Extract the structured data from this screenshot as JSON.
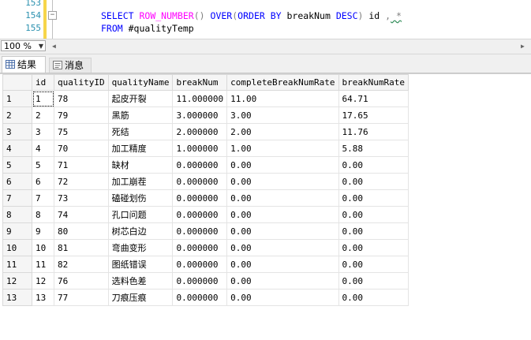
{
  "editor": {
    "line_numbers": [
      "153",
      "154",
      "155"
    ],
    "line154": {
      "kw_select": "SELECT",
      "fn_rownumber": "ROW_NUMBER",
      "paren1": "()",
      "kw_over": "OVER",
      "open_paren": "(",
      "kw_orderby": "ORDER BY",
      "col": " breakNum ",
      "kw_desc": "DESC",
      "close_rest": ")",
      "alias": " id ",
      "comma": ",",
      "star": " *"
    },
    "line155": {
      "kw_from": "FROM",
      "table": " #qualityTemp"
    }
  },
  "zoom": {
    "value": "100 %"
  },
  "tabs": [
    {
      "label": "结果",
      "icon": "grid-icon"
    },
    {
      "label": "消息",
      "icon": "message-icon"
    }
  ],
  "grid": {
    "columns": [
      "id",
      "qualityID",
      "qualityName",
      "breakNum",
      "completeBreakNumRate",
      "breakNumRate"
    ],
    "rows": [
      {
        "n": "1",
        "id": "1",
        "qualityID": "78",
        "qualityName": "起皮开裂",
        "breakNum": "11.000000",
        "completeBreakNumRate": "11.00",
        "breakNumRate": "64.71"
      },
      {
        "n": "2",
        "id": "2",
        "qualityID": "79",
        "qualityName": "黑筋",
        "breakNum": "3.000000",
        "completeBreakNumRate": "3.00",
        "breakNumRate": "17.65"
      },
      {
        "n": "3",
        "id": "3",
        "qualityID": "75",
        "qualityName": "死结",
        "breakNum": "2.000000",
        "completeBreakNumRate": "2.00",
        "breakNumRate": "11.76"
      },
      {
        "n": "4",
        "id": "4",
        "qualityID": "70",
        "qualityName": "加工精度",
        "breakNum": "1.000000",
        "completeBreakNumRate": "1.00",
        "breakNumRate": "5.88"
      },
      {
        "n": "5",
        "id": "5",
        "qualityID": "71",
        "qualityName": "缺材",
        "breakNum": "0.000000",
        "completeBreakNumRate": "0.00",
        "breakNumRate": "0.00"
      },
      {
        "n": "6",
        "id": "6",
        "qualityID": "72",
        "qualityName": "加工崩茬",
        "breakNum": "0.000000",
        "completeBreakNumRate": "0.00",
        "breakNumRate": "0.00"
      },
      {
        "n": "7",
        "id": "7",
        "qualityID": "73",
        "qualityName": "磕碰划伤",
        "breakNum": "0.000000",
        "completeBreakNumRate": "0.00",
        "breakNumRate": "0.00"
      },
      {
        "n": "8",
        "id": "8",
        "qualityID": "74",
        "qualityName": "孔口问题",
        "breakNum": "0.000000",
        "completeBreakNumRate": "0.00",
        "breakNumRate": "0.00"
      },
      {
        "n": "9",
        "id": "9",
        "qualityID": "80",
        "qualityName": "树芯白边",
        "breakNum": "0.000000",
        "completeBreakNumRate": "0.00",
        "breakNumRate": "0.00"
      },
      {
        "n": "10",
        "id": "10",
        "qualityID": "81",
        "qualityName": "弯曲变形",
        "breakNum": "0.000000",
        "completeBreakNumRate": "0.00",
        "breakNumRate": "0.00"
      },
      {
        "n": "11",
        "id": "11",
        "qualityID": "82",
        "qualityName": "图纸错误",
        "breakNum": "0.000000",
        "completeBreakNumRate": "0.00",
        "breakNumRate": "0.00"
      },
      {
        "n": "12",
        "id": "12",
        "qualityID": "76",
        "qualityName": "选料色差",
        "breakNum": "0.000000",
        "completeBreakNumRate": "0.00",
        "breakNumRate": "0.00"
      },
      {
        "n": "13",
        "id": "13",
        "qualityID": "77",
        "qualityName": "刀痕压痕",
        "breakNum": "0.000000",
        "completeBreakNumRate": "0.00",
        "breakNumRate": "0.00"
      }
    ]
  },
  "colors": {
    "keyword": "#0000ff",
    "function": "#ff00ff",
    "line_number": "#2b91af",
    "change_bar": "#f6d54a"
  }
}
